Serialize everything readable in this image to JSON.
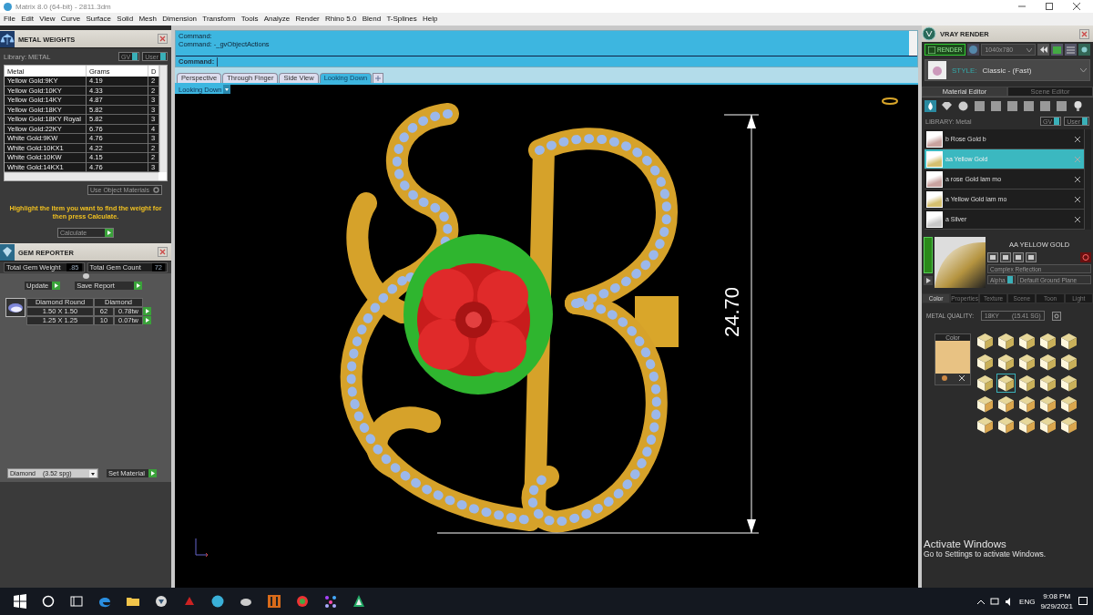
{
  "window": {
    "title": "Matrix 8.0 (64-bit) - 2811.3dm"
  },
  "menu": [
    "File",
    "Edit",
    "View",
    "Curve",
    "Surface",
    "Solid",
    "Mesh",
    "Dimension",
    "Transform",
    "Tools",
    "Analyze",
    "Render",
    "Rhino 5.0",
    "Blend",
    "T-Splines",
    "Help"
  ],
  "metal_weights": {
    "title": "METAL WEIGHTS",
    "library_label": "Library: METAL",
    "filters": [
      {
        "label": "GV",
        "on": true
      },
      {
        "label": "User",
        "on": true
      }
    ],
    "columns": [
      "Metal",
      "Grams",
      "D"
    ],
    "rows": [
      [
        "Yellow Gold:9KY",
        "4.19",
        "2"
      ],
      [
        "Yellow Gold:10KY",
        "4.33",
        "2"
      ],
      [
        "Yellow Gold:14KY",
        "4.87",
        "3"
      ],
      [
        "Yellow Gold:18KY",
        "5.82",
        "3"
      ],
      [
        "Yellow Gold:18KY Royal",
        "5.82",
        "3"
      ],
      [
        "Yellow Gold:22KY",
        "6.76",
        "4"
      ],
      [
        "White Gold:9KW",
        "4.76",
        "3"
      ],
      [
        "White Gold:10KX1",
        "4.22",
        "2"
      ],
      [
        "White Gold:10KW",
        "4.15",
        "2"
      ],
      [
        "White Gold:14KX1",
        "4.76",
        "3"
      ]
    ],
    "use_object_materials": "Use Object Materials",
    "hint": "Highlight the item you want to find the weight for then press Calculate.",
    "calculate": "Calculate"
  },
  "gem_reporter": {
    "title": "GEM REPORTER",
    "totals": [
      {
        "label": "Total Gem Weight",
        "value": ".85"
      },
      {
        "label": "Total Gem Count",
        "value": "72"
      }
    ],
    "buttons": [
      "Update",
      "Save Report"
    ],
    "columns": [
      "Diamond Round",
      "Diamond"
    ],
    "rows": [
      [
        "1.50 X 1.50",
        "62",
        "0.78tw"
      ],
      [
        "1.25 X 1.25",
        "10",
        "0.07tw"
      ]
    ],
    "material": "Diamond",
    "material_density": "(3.52 spg)",
    "set_material": "Set Material"
  },
  "command": {
    "lines": [
      "Command:",
      "Command: -_gvObjectActions"
    ],
    "prompt": "Command:"
  },
  "viewport_tabs": [
    {
      "label": "Perspective",
      "selected": false
    },
    {
      "label": "Through Finger",
      "selected": false
    },
    {
      "label": "Side View",
      "selected": false
    },
    {
      "label": "Looking Down",
      "selected": true
    }
  ],
  "viewport": {
    "label": "Looking Down",
    "dimension": "24.70"
  },
  "vray": {
    "title": "VRAY RENDER",
    "render": "RENDER",
    "resolution": "1040x780",
    "style_label": "STYLE:",
    "style": "Classic - (Fast)",
    "tabs": [
      {
        "label": "Material Editor",
        "selected": true
      },
      {
        "label": "Scene Editor",
        "selected": false
      }
    ],
    "library_label": "LIBRARY: Metal",
    "filters": [
      {
        "label": "GV",
        "on": true
      },
      {
        "label": "User",
        "on": true
      }
    ],
    "materials": [
      {
        "name": "b Rose Gold b",
        "color": "#c9a3a0",
        "selected": false
      },
      {
        "name": "aa Yellow Gold",
        "color": "#d6c070",
        "selected": true
      },
      {
        "name": "a rose Gold lam mo",
        "color": "#c9a3a0",
        "selected": false
      },
      {
        "name": "a Yellow Gold lam mo",
        "color": "#d6c070",
        "selected": false
      },
      {
        "name": "a Silver",
        "color": "#c8c8c8",
        "selected": false
      }
    ],
    "material_title": "AA YELLOW GOLD",
    "reflection": "Complex Reflection",
    "alpha": "Alpha",
    "ground": "Default Ground Plane",
    "sub_tabs": [
      {
        "label": "Color",
        "selected": true
      },
      {
        "label": "Properties",
        "selected": false
      },
      {
        "label": "Texture",
        "selected": false
      },
      {
        "label": "Scene",
        "selected": false
      },
      {
        "label": "Toon",
        "selected": false
      },
      {
        "label": "Light",
        "selected": false
      }
    ],
    "quality_label": "METAL QUALITY:",
    "quality": "18KY",
    "quality_sg": "(15.41 SG)",
    "color_box": {
      "label": "Color",
      "color": "#e8c283"
    },
    "presets": [
      {
        "selected": false
      },
      {
        "selected": false
      },
      {
        "selected": false
      },
      {
        "selected": false
      },
      {
        "selected": false
      },
      {
        "selected": false
      },
      {
        "selected": false
      },
      {
        "selected": false
      },
      {
        "selected": false
      },
      {
        "selected": false
      },
      {
        "selected": false
      },
      {
        "selected": true
      },
      {
        "selected": false
      },
      {
        "selected": false
      },
      {
        "selected": false
      },
      {
        "selected": false
      },
      {
        "selected": false
      },
      {
        "selected": false
      },
      {
        "selected": false
      },
      {
        "selected": false
      },
      {
        "selected": false
      },
      {
        "selected": false
      },
      {
        "selected": false
      },
      {
        "selected": false
      },
      {
        "selected": false
      }
    ]
  },
  "activation": {
    "title": "Activate Windows",
    "text": "Go to Settings to activate Windows."
  },
  "taskbar": {
    "language": "ENG",
    "time": "9:08 PM",
    "date": "9/29/2021"
  }
}
